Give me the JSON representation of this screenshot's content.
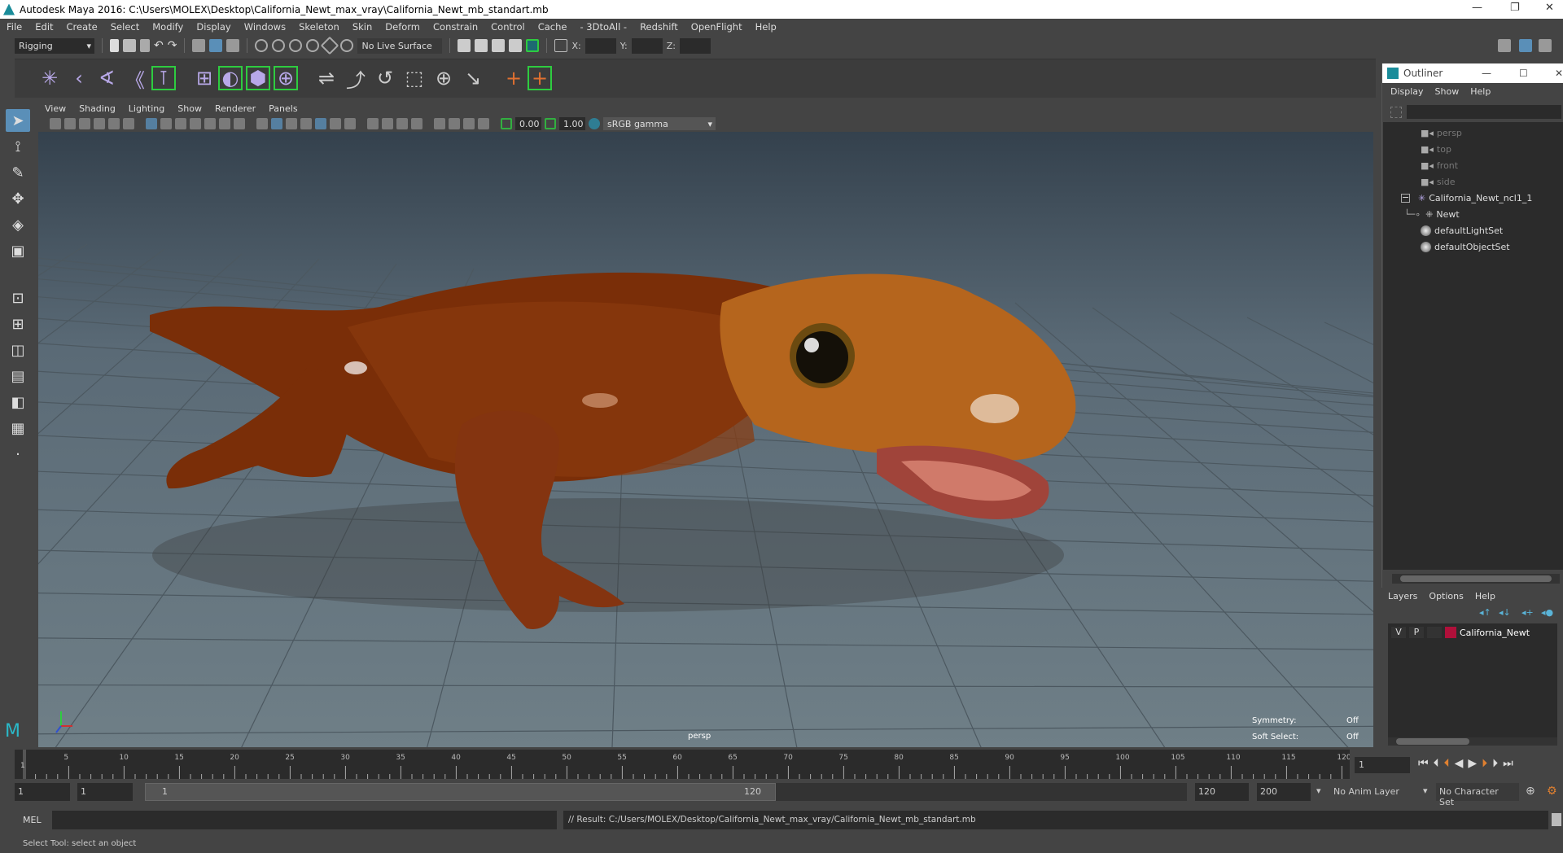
{
  "window": {
    "title": "Autodesk Maya 2016: C:\\Users\\MOLEX\\Desktop\\California_Newt_max_vray\\California_Newt_mb_standart.mb",
    "minimize": "—",
    "maximize": "❐",
    "close": "✕"
  },
  "menubar": [
    "File",
    "Edit",
    "Create",
    "Select",
    "Modify",
    "Display",
    "Windows",
    "Skeleton",
    "Skin",
    "Deform",
    "Constrain",
    "Control",
    "Cache",
    "- 3DtoAll -",
    "Redshift",
    "OpenFlight",
    "Help"
  ],
  "statusline": {
    "menuset": "Rigging",
    "live_surface": "No Live Surface",
    "x_label": "X:",
    "y_label": "Y:",
    "z_label": "Z:"
  },
  "panel_menu": [
    "View",
    "Shading",
    "Lighting",
    "Show",
    "Renderer",
    "Panels"
  ],
  "viewport_toolbar": {
    "exposure": "0.00",
    "gamma": "1.00",
    "color_space": "sRGB gamma"
  },
  "viewport": {
    "camera": "persp",
    "symmetry_label": "Symmetry:",
    "symmetry_value": "Off",
    "soft_select_label": "Soft Select:",
    "soft_select_value": "Off"
  },
  "outliner": {
    "title": "Outliner",
    "menu": [
      "Display",
      "Show",
      "Help"
    ],
    "items": [
      {
        "label": "persp",
        "icon": "camera-icon"
      },
      {
        "label": "top",
        "icon": "camera-icon"
      },
      {
        "label": "front",
        "icon": "camera-icon"
      },
      {
        "label": "side",
        "icon": "camera-icon"
      },
      {
        "label": "California_Newt_ncl1_1",
        "icon": "nucleus-icon"
      },
      {
        "label": "Newt",
        "icon": "mesh-icon"
      },
      {
        "label": "defaultLightSet",
        "icon": "set-icon"
      },
      {
        "label": "defaultObjectSet",
        "icon": "set-icon"
      }
    ]
  },
  "layers": {
    "menu": [
      "Layers",
      "Options",
      "Help"
    ],
    "rows": [
      {
        "v": "V",
        "p": "P",
        "name": "California_Newt",
        "color": "#b0103a"
      }
    ]
  },
  "timeline": {
    "ticks": [
      "5",
      "10",
      "15",
      "20",
      "25",
      "30",
      "35",
      "40",
      "45",
      "50",
      "55",
      "60",
      "65",
      "70",
      "75",
      "80",
      "85",
      "90",
      "95",
      "100",
      "105",
      "110",
      "115",
      "120"
    ],
    "current_marker": "1",
    "current_frame": "1"
  },
  "range": {
    "start": "1",
    "playback_start": "1",
    "slider_start": "1",
    "slider_end": "120",
    "playback_end": "120",
    "end": "200",
    "anim_layer": "No Anim Layer",
    "character_set": "No Character Set"
  },
  "command": {
    "mode": "MEL",
    "result": "// Result: C:/Users/MOLEX/Desktop/California_Newt_max_vray/California_Newt_mb_standart.mb"
  },
  "helpline": "Select Tool: select an object",
  "colors": {
    "newt_body": "#7a2e08",
    "newt_head": "#b5651d",
    "accent": "#5ab4d8",
    "green": "#2ecc40"
  }
}
